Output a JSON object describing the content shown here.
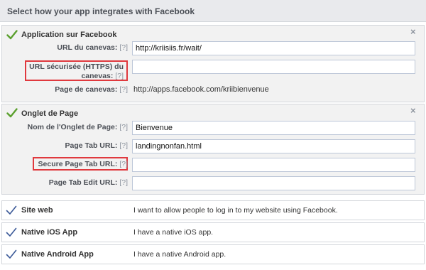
{
  "header": {
    "title": "Select how your app integrates with Facebook"
  },
  "facebook_app": {
    "title": "Application sur Facebook",
    "close_symbol": "×",
    "canvas_url": {
      "label": "URL du canevas:",
      "help": "[?]",
      "value": "http://kriisiis.fr/wait/"
    },
    "secure_canvas_url": {
      "label": "URL sécurisée (HTTPS) du canevas:",
      "help": "[?]",
      "value": ""
    },
    "canvas_page": {
      "label": "Page de canevas:",
      "help": "[?]",
      "value": "http://apps.facebook.com/kriibienvenue"
    }
  },
  "page_tab": {
    "title": "Onglet de Page",
    "close_symbol": "×",
    "tab_name": {
      "label": "Nom de l'Onglet de Page:",
      "help": "[?]",
      "value": "Bienvenue"
    },
    "tab_url": {
      "label": "Page Tab URL:",
      "help": "[?]",
      "value": "landingnonfan.html"
    },
    "secure_tab_url": {
      "label": "Secure Page Tab URL:",
      "help": "[?]",
      "value": ""
    },
    "tab_edit_url": {
      "label": "Page Tab Edit URL:",
      "help": "[?]",
      "value": ""
    }
  },
  "options": [
    {
      "title": "Site web",
      "description": "I want to allow people to log in to my website using Facebook."
    },
    {
      "title": "Native iOS App",
      "description": "I have a native iOS app."
    },
    {
      "title": "Native Android App",
      "description": "I have a native Android app."
    }
  ],
  "colors": {
    "check_green": "#5ba02e",
    "check_blue": "#3b5998",
    "highlight_red": "#e0393e"
  }
}
